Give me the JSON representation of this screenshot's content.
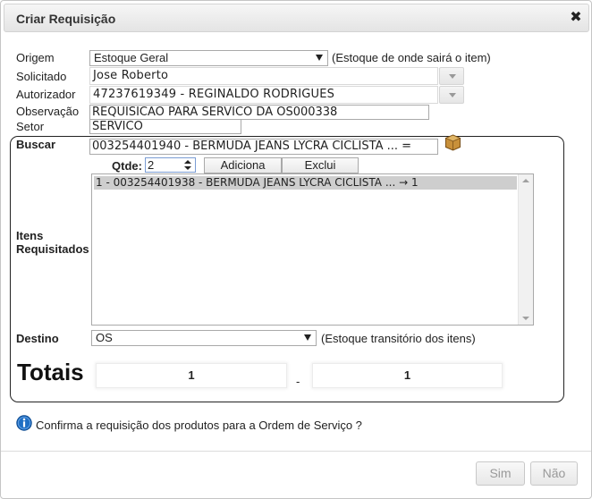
{
  "dialog": {
    "title": "Criar Requisição",
    "close_symbol": "✖"
  },
  "form": {
    "origem": {
      "label": "Origem",
      "value": "Estoque Geral",
      "hint": "(Estoque de onde sairá o item)"
    },
    "solicitado": {
      "label": "Solicitado",
      "value": "Jose Roberto"
    },
    "autorizador": {
      "label": "Autorizador",
      "value": "47237619349 - REGINALDO RODRIGUES"
    },
    "observacao": {
      "label": "Observação",
      "value": "REQUISICAO PARA SERVICO DA OS000338"
    },
    "setor": {
      "label": "Setor",
      "value": "SERVICO"
    }
  },
  "items_panel": {
    "buscar_label": "Buscar",
    "buscar_value": "003254401940 - BERMUDA JEANS LYCRA CICLISTA  ... =",
    "qtde_label": "Qtde:",
    "qtde_value": "2",
    "add_label": "Adiciona",
    "remove_label": "Exclui",
    "itens_label_line1": "Itens",
    "itens_label_line2": "Requisitados",
    "items": [
      "1 - 003254401938 - BERMUDA JEANS LYCRA CICLISTA ... → 1"
    ],
    "destino_label": "Destino",
    "destino_value": "OS",
    "destino_hint": "(Estoque transitório dos itens)",
    "totais_label": "Totais",
    "total_left": "1",
    "total_separator": "-",
    "total_right": "1"
  },
  "confirm_text": "Confirma a requisição dos produtos para a Ordem de Serviço ?",
  "footer": {
    "yes_label": "Sim",
    "no_label": "Não"
  },
  "icons": {
    "close": "close-icon",
    "package": "package-icon",
    "info": "info-icon"
  },
  "colors": {
    "info_blue": "#1f6fc4",
    "package_brown": "#b07a2e"
  }
}
